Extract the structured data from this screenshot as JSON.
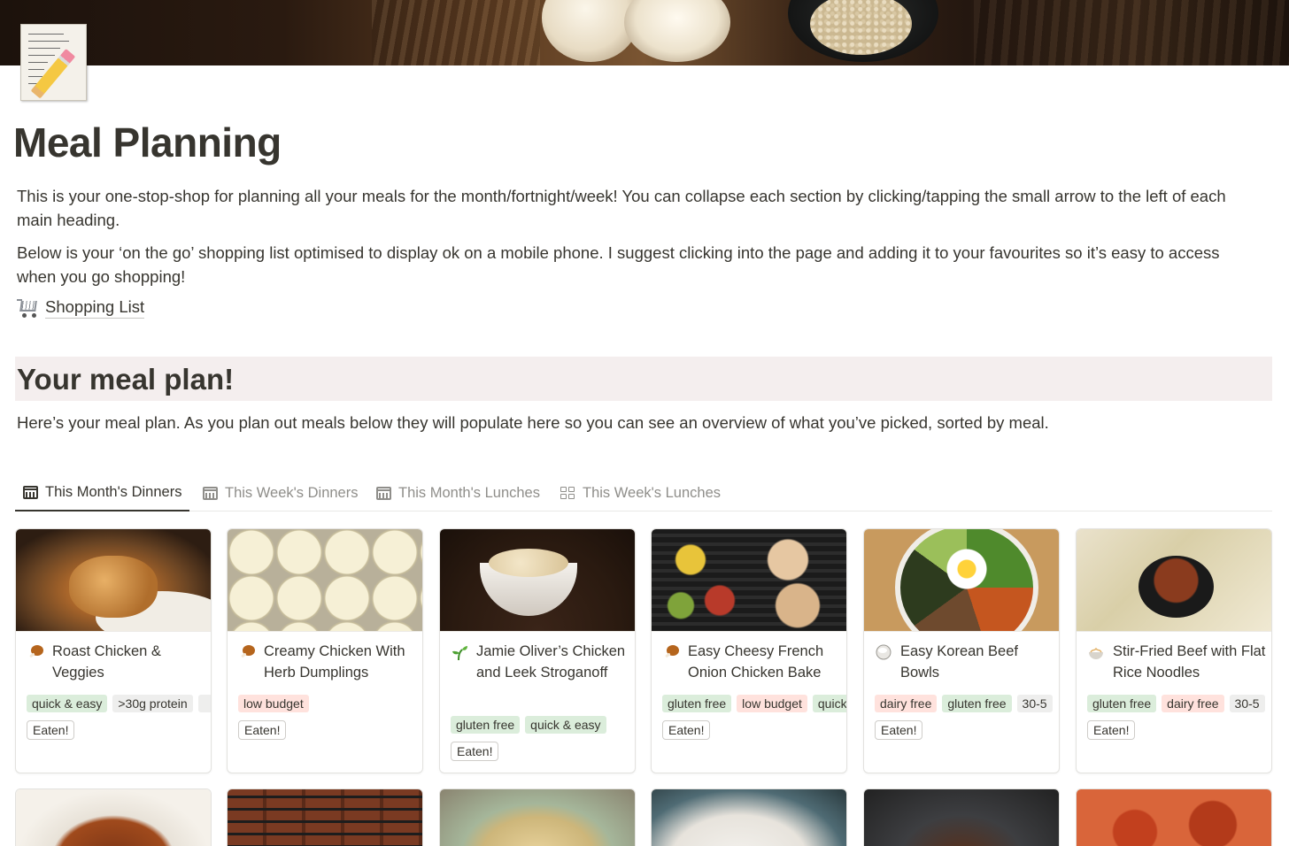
{
  "page": {
    "title": "Meal Planning",
    "intro": "This is your one-stop-shop for planning all your meals for the month/fortnight/week! You can collapse each section by clicking/tapping the small arrow to the left of each main heading.",
    "shopping_note": "Below is your ‘on the go’ shopping list optimised to display ok on a mobile phone. I suggest clicking into the page and adding it to your favourites so it’s easy to access when you go shopping!",
    "shopping_link": "Shopping List"
  },
  "section": {
    "title": "Your meal plan!",
    "description": "Here’s your meal plan. As you plan out meals below they will populate here so you can see an overview of what you’ve picked, sorted by meal."
  },
  "tabs": [
    {
      "label": "This Month's Dinners",
      "icon": "calendar-icon",
      "active": true
    },
    {
      "label": "This Week's Dinners",
      "icon": "calendar-icon",
      "active": false
    },
    {
      "label": "This Month's Lunches",
      "icon": "calendar-icon",
      "active": false
    },
    {
      "label": "This Week's Lunches",
      "icon": "gallery-icon",
      "active": false
    }
  ],
  "cards": [
    {
      "name": "Roast Chicken & Veggies",
      "icon": "poultry-leg-icon",
      "tags": [
        {
          "text": "quick & easy",
          "color": "green"
        },
        {
          "text": ">30g protein",
          "color": "gray"
        }
      ],
      "eaten": "Eaten!"
    },
    {
      "name": "Creamy Chicken With Herb Dumplings",
      "icon": "poultry-leg-icon",
      "tags": [
        {
          "text": "low budget",
          "color": "red"
        }
      ],
      "eaten": "Eaten!"
    },
    {
      "name": "Jamie Oliver’s Chicken and Leek Stroganoff",
      "icon": "seedling-icon",
      "tags": [
        {
          "text": "gluten free",
          "color": "green"
        },
        {
          "text": "quick & easy",
          "color": "green"
        }
      ],
      "eaten": "Eaten!"
    },
    {
      "name": "Easy Cheesy French Onion Chicken Bake",
      "icon": "poultry-leg-icon",
      "tags": [
        {
          "text": "gluten free",
          "color": "green"
        },
        {
          "text": "low budget",
          "color": "red"
        },
        {
          "text": "quick & easy",
          "color": "green"
        }
      ],
      "eaten": "Eaten!"
    },
    {
      "name": "Easy Korean Beef Bowls",
      "icon": "rice-bowl-icon",
      "tags": [
        {
          "text": "dairy free",
          "color": "red"
        },
        {
          "text": "gluten free",
          "color": "green"
        },
        {
          "text": "30-5",
          "color": "gray"
        }
      ],
      "eaten": "Eaten!"
    },
    {
      "name": "Stir-Fried Beef with Flat Rice Noodles",
      "icon": "noodle-bowl-icon",
      "tags": [
        {
          "text": "gluten free",
          "color": "green"
        },
        {
          "text": "dairy free",
          "color": "red"
        },
        {
          "text": "30-5",
          "color": "gray"
        }
      ],
      "eaten": "Eaten!"
    }
  ],
  "colors": {
    "text": "#37352f",
    "muted": "#8f8e8a",
    "tag_green": "#dbeddb",
    "tag_red": "#ffe2dd",
    "tag_gray": "#eeeeed",
    "heading_bg": "#f4eeee"
  }
}
